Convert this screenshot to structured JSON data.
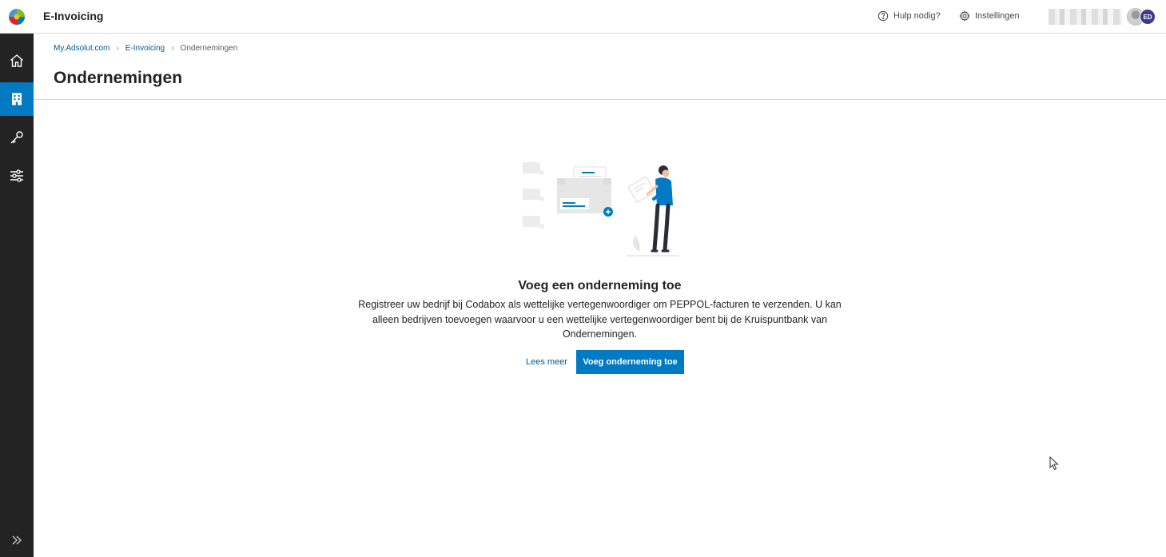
{
  "app": {
    "title": "E-Invoicing",
    "logo_icon": "wolters-kluwer-logo"
  },
  "header": {
    "help_label": "Hulp nodig?",
    "help_icon": "question-circle-icon",
    "settings_label": "Instellingen",
    "settings_icon": "gear-icon",
    "avatar_initials": "ED",
    "avatar_color": "#3d3a8c"
  },
  "sidebar": {
    "items": [
      {
        "name": "home",
        "icon": "home-icon",
        "active": false
      },
      {
        "name": "companies",
        "icon": "building-icon",
        "active": true
      },
      {
        "name": "keys",
        "icon": "key-icon",
        "active": false
      },
      {
        "name": "filters",
        "icon": "sliders-icon",
        "active": false
      }
    ],
    "expand_icon": "double-chevron-right-icon",
    "accent": "#007ac3"
  },
  "breadcrumb": {
    "items": [
      "My.Adsolut.com",
      "E-Invoicing",
      "Ondernemingen"
    ]
  },
  "page": {
    "title": "Ondernemingen"
  },
  "empty_state": {
    "title": "Voeg een onderneming toe",
    "description": "Registreer uw bedrijf bij Codabox als wettelijke vertegenwoordiger om PEPPOL-facturen te verzenden. U kan alleen bedrijven toevoegen waarvoor u een wettelijke vertegenwoordiger bent bij de Kruispuntbank van Ondernemingen.",
    "read_more_label": "Lees meer",
    "add_button_label": "Voeg onderneming toe",
    "primary_color": "#007ac3"
  }
}
